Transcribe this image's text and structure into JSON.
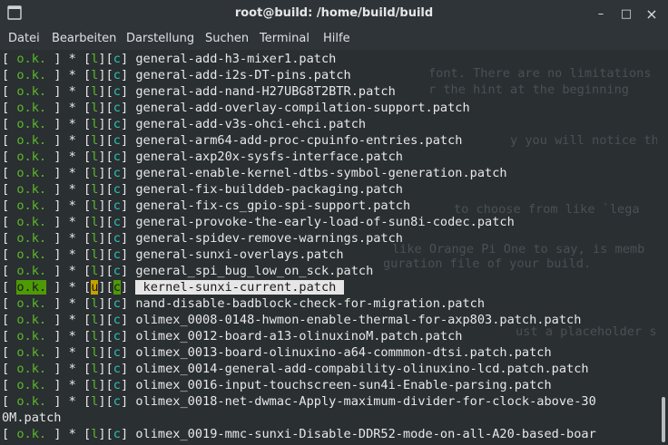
{
  "window": {
    "title": "root@build: /home/build/build",
    "controls": {
      "minimize": "–",
      "maximize": "□",
      "close": "×"
    }
  },
  "menu": [
    "Datei",
    "Bearbeiten",
    "Darstellung",
    "Suchen",
    "Terminal",
    "Hilfe"
  ],
  "ghost_text": [
    "font. There are no limitations exc",
    "r the hint at the beginning",
    "y you will notice there",
    "to choose from like `lega",
    "like Orange Pi One to say, is memb",
    "guration file of your build.",
    "ust a placeholder s"
  ],
  "lines": [
    {
      "status": "o.k.",
      "l": "l",
      "c": "c",
      "name": "general-add-h3-mixer1.patch"
    },
    {
      "status": "o.k.",
      "l": "l",
      "c": "c",
      "name": "general-add-i2s-DT-pins.patch"
    },
    {
      "status": "o.k.",
      "l": "l",
      "c": "c",
      "name": "general-add-nand-H27UBG8T2BTR.patch"
    },
    {
      "status": "o.k.",
      "l": "l",
      "c": "c",
      "name": "general-add-overlay-compilation-support.patch"
    },
    {
      "status": "o.k.",
      "l": "l",
      "c": "c",
      "name": "general-add-v3s-ohci-ehci.patch"
    },
    {
      "status": "o.k.",
      "l": "l",
      "c": "c",
      "name": "general-arm64-add-proc-cpuinfo-entries.patch"
    },
    {
      "status": "o.k.",
      "l": "l",
      "c": "c",
      "name": "general-axp20x-sysfs-interface.patch"
    },
    {
      "status": "o.k.",
      "l": "l",
      "c": "c",
      "name": "general-enable-kernel-dtbs-symbol-generation.patch"
    },
    {
      "status": "o.k.",
      "l": "l",
      "c": "c",
      "name": "general-fix-builddeb-packaging.patch"
    },
    {
      "status": "o.k.",
      "l": "l",
      "c": "c",
      "name": "general-fix-cs_gpio-spi-support.patch"
    },
    {
      "status": "o.k.",
      "l": "l",
      "c": "c",
      "name": "general-provoke-the-early-load-of-sun8i-codec.patch"
    },
    {
      "status": "o.k.",
      "l": "l",
      "c": "c",
      "name": "general-spidev-remove-warnings.patch"
    },
    {
      "status": "o.k.",
      "l": "l",
      "c": "c",
      "name": "general-sunxi-overlays.patch"
    },
    {
      "status": "o.k.",
      "l": "l",
      "c": "c",
      "name": "general_spi_bug_low_on_sck.patch"
    },
    {
      "status": "o.k.",
      "l": "u",
      "c": "c",
      "name": "kernel-sunxi-current.patch",
      "selected": true
    },
    {
      "status": "o.k.",
      "l": "l",
      "c": "c",
      "name": "nand-disable-badblock-check-for-migration.patch"
    },
    {
      "status": "o.k.",
      "l": "l",
      "c": "c",
      "name": "olimex_0008-0148-hwmon-enable-thermal-for-axp803.patch.patch"
    },
    {
      "status": "o.k.",
      "l": "l",
      "c": "c",
      "name": "olimex_0012-board-a13-olinuxinoM.patch.patch"
    },
    {
      "status": "o.k.",
      "l": "l",
      "c": "c",
      "name": "olimex_0013-board-olinuxino-a64-commmon-dtsi.patch.patch"
    },
    {
      "status": "o.k.",
      "l": "l",
      "c": "c",
      "name": "olimex_0014-general-add-compability-olinuxino-lcd.patch.patch"
    },
    {
      "status": "o.k.",
      "l": "l",
      "c": "c",
      "name": "olimex_0016-input-touchscreen-sun4i-Enable-parsing.patch"
    },
    {
      "status": "o.k.",
      "l": "l",
      "c": "c",
      "name": "olimex_0018-net-dwmac-Apply-maximum-divider-for-clock-above-30"
    },
    {
      "wrap": "0M.patch"
    },
    {
      "status": "o.k.",
      "l": "l",
      "c": "c",
      "name": "olimex_0019-mmc-sunxi-Disable-DDR52-mode-on-all-A20-based-boar"
    }
  ]
}
